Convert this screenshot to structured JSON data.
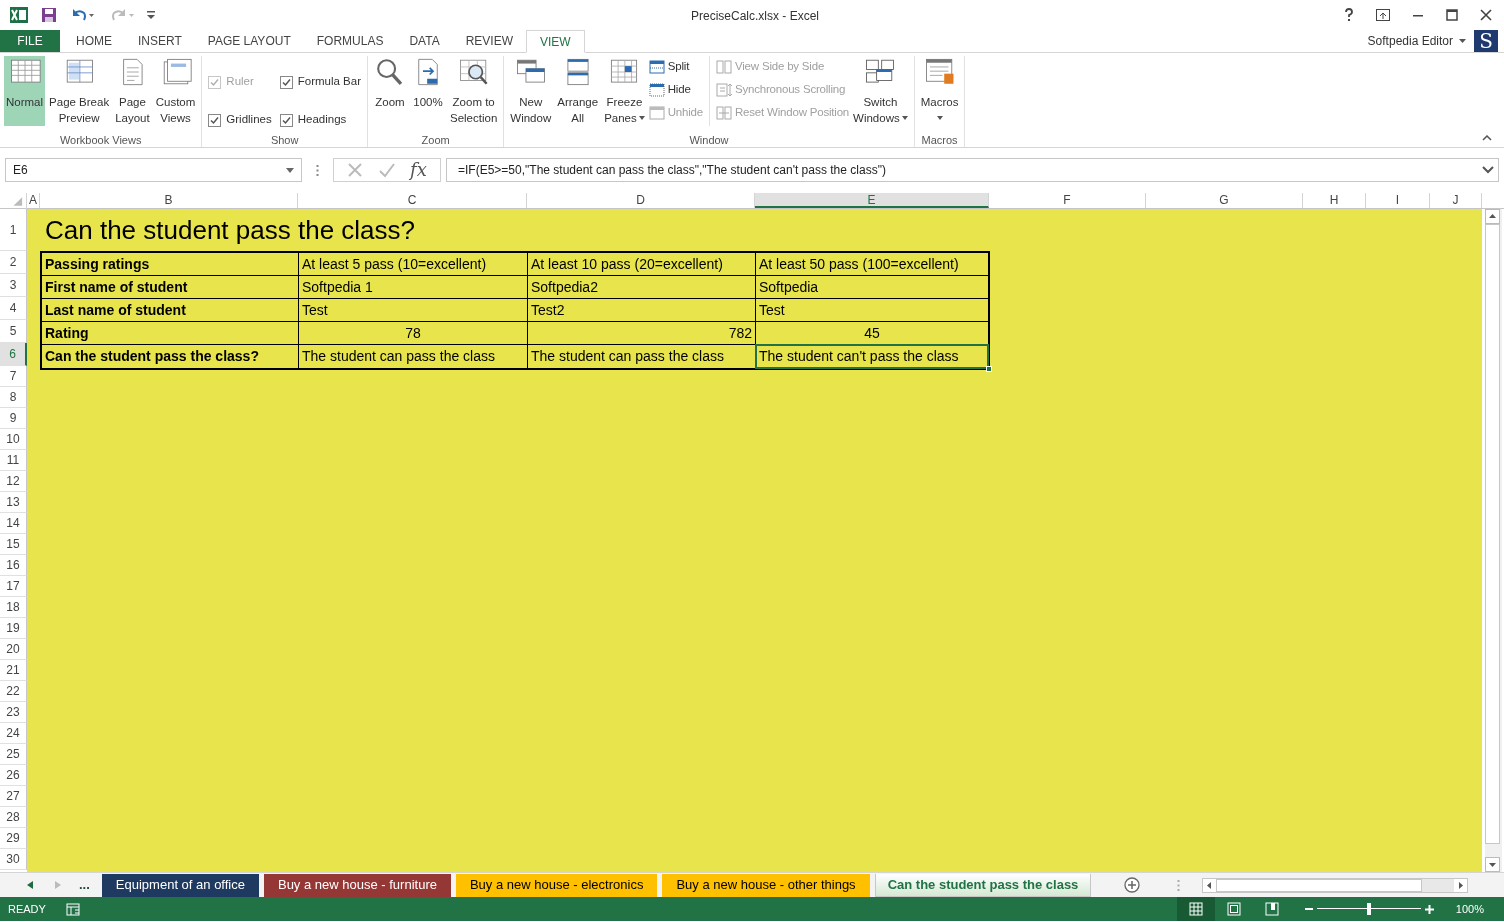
{
  "window": {
    "title": "PreciseCalc.xlsx - Excel"
  },
  "ribbon_tabs": [
    {
      "label": "FILE",
      "kind": "backstage",
      "selected": false
    },
    {
      "label": "HOME",
      "kind": "tab",
      "selected": false
    },
    {
      "label": "INSERT",
      "kind": "tab",
      "selected": false
    },
    {
      "label": "PAGE LAYOUT",
      "kind": "tab",
      "selected": false
    },
    {
      "label": "FORMULAS",
      "kind": "tab",
      "selected": false
    },
    {
      "label": "DATA",
      "kind": "tab",
      "selected": false
    },
    {
      "label": "REVIEW",
      "kind": "tab",
      "selected": false
    },
    {
      "label": "VIEW",
      "kind": "tab",
      "selected": true
    }
  ],
  "account": {
    "name": "Softpedia Editor",
    "avatar": "S"
  },
  "ribbon_groups": [
    {
      "label": "Workbook Views",
      "items": [
        {
          "kind": "large",
          "lines": [
            "Normal"
          ],
          "selected": true
        },
        {
          "kind": "large",
          "lines": [
            "Page Break",
            "Preview"
          ],
          "selected": false
        },
        {
          "kind": "large",
          "lines": [
            "Page",
            "Layout"
          ],
          "selected": false
        },
        {
          "kind": "large",
          "lines": [
            "Custom",
            "Views"
          ],
          "selected": false
        }
      ]
    },
    {
      "label": "Show",
      "items": [
        {
          "kind": "check",
          "label": "Ruler",
          "checked": true,
          "disabled": true
        },
        {
          "kind": "check",
          "label": "Gridlines",
          "checked": true,
          "disabled": false
        },
        {
          "kind": "check",
          "label": "Formula Bar",
          "checked": true,
          "disabled": false
        },
        {
          "kind": "check",
          "label": "Headings",
          "checked": true,
          "disabled": false
        }
      ]
    },
    {
      "label": "Zoom",
      "items": [
        {
          "kind": "large",
          "lines": [
            "Zoom"
          ]
        },
        {
          "kind": "large",
          "lines": [
            "100%"
          ]
        },
        {
          "kind": "large",
          "lines": [
            "Zoom to",
            "Selection"
          ]
        }
      ]
    },
    {
      "label": "Window",
      "items": [
        {
          "kind": "large",
          "lines": [
            "New",
            "Window"
          ]
        },
        {
          "kind": "large",
          "lines": [
            "Arrange",
            "All"
          ]
        },
        {
          "kind": "large",
          "lines": [
            "Freeze",
            "Panes"
          ],
          "dropdown": true
        },
        {
          "kind": "small",
          "label": "Split",
          "disabled": false
        },
        {
          "kind": "small",
          "label": "Hide",
          "disabled": false
        },
        {
          "kind": "small",
          "label": "Unhide",
          "disabled": true
        },
        {
          "kind": "small",
          "label": "View Side by Side",
          "disabled": true
        },
        {
          "kind": "small",
          "label": "Synchronous Scrolling",
          "disabled": true
        },
        {
          "kind": "small",
          "label": "Reset Window Position",
          "disabled": true
        },
        {
          "kind": "large",
          "lines": [
            "Switch",
            "Windows"
          ],
          "dropdown": true
        }
      ]
    },
    {
      "label": "Macros",
      "items": [
        {
          "kind": "large",
          "lines": [
            "Macros"
          ],
          "dropdown": true
        }
      ]
    }
  ],
  "formula_bar": {
    "name_box": "E6",
    "function_label": "fx",
    "formula": "=IF(E5>=50,\"The student can pass the class\",\"The student can't pass the class\")"
  },
  "columns": [
    {
      "label": "A",
      "selected": false
    },
    {
      "label": "B",
      "selected": false
    },
    {
      "label": "C",
      "selected": false
    },
    {
      "label": "D",
      "selected": false
    },
    {
      "label": "E",
      "selected": true
    },
    {
      "label": "F",
      "selected": false
    },
    {
      "label": "G",
      "selected": false
    },
    {
      "label": "H",
      "selected": false
    },
    {
      "label": "I",
      "selected": false
    },
    {
      "label": "J",
      "selected": false
    }
  ],
  "row_headers": [
    {
      "label": "1",
      "selected": false
    },
    {
      "label": "2",
      "selected": false
    },
    {
      "label": "3",
      "selected": false
    },
    {
      "label": "4",
      "selected": false
    },
    {
      "label": "5",
      "selected": false
    },
    {
      "label": "6",
      "selected": true
    },
    {
      "label": "7",
      "selected": false
    },
    {
      "label": "8",
      "selected": false
    },
    {
      "label": "9",
      "selected": false
    },
    {
      "label": "10",
      "selected": false
    },
    {
      "label": "11",
      "selected": false
    },
    {
      "label": "12",
      "selected": false
    },
    {
      "label": "13",
      "selected": false
    },
    {
      "label": "14",
      "selected": false
    },
    {
      "label": "15",
      "selected": false
    },
    {
      "label": "16",
      "selected": false
    },
    {
      "label": "17",
      "selected": false
    },
    {
      "label": "18",
      "selected": false
    },
    {
      "label": "19",
      "selected": false
    },
    {
      "label": "20",
      "selected": false
    },
    {
      "label": "21",
      "selected": false
    },
    {
      "label": "22",
      "selected": false
    },
    {
      "label": "23",
      "selected": false
    },
    {
      "label": "24",
      "selected": false
    },
    {
      "label": "25",
      "selected": false
    },
    {
      "label": "26",
      "selected": false
    },
    {
      "label": "27",
      "selected": false
    },
    {
      "label": "28",
      "selected": false
    },
    {
      "label": "29",
      "selected": false
    },
    {
      "label": "30",
      "selected": false
    }
  ],
  "sheet": {
    "title": "Can the student pass the class?",
    "table": [
      {
        "label": "Passing ratings",
        "cells": [
          {
            "text": "At least 5 pass (10=excellent)",
            "kind": "left",
            "selected": false
          },
          {
            "text": "At least 10 pass (20=excellent)",
            "kind": "left",
            "selected": false
          },
          {
            "text": "At least 50 pass (100=excellent)",
            "kind": "left",
            "selected": false
          }
        ]
      },
      {
        "label": "First name of student",
        "cells": [
          {
            "text": "Softpedia 1",
            "kind": "left",
            "selected": false
          },
          {
            "text": "Softpedia2",
            "kind": "left",
            "selected": false
          },
          {
            "text": "Softpedia",
            "kind": "left",
            "selected": false
          }
        ]
      },
      {
        "label": "Last name of student",
        "cells": [
          {
            "text": "Test",
            "kind": "left",
            "selected": false
          },
          {
            "text": "Test2",
            "kind": "left",
            "selected": false
          },
          {
            "text": "Test",
            "kind": "left",
            "selected": false
          }
        ]
      },
      {
        "label": "Rating",
        "cells": [
          {
            "text": "78",
            "kind": "center",
            "selected": false
          },
          {
            "text": "782",
            "kind": "right",
            "selected": false
          },
          {
            "text": "45",
            "kind": "center",
            "selected": false
          }
        ]
      },
      {
        "label": "Can the student pass the class?",
        "cells": [
          {
            "text": "The student can pass the class",
            "kind": "left",
            "selected": false
          },
          {
            "text": "The student can pass the class",
            "kind": "left",
            "selected": false
          },
          {
            "text": "The student can't pass the class",
            "kind": "left",
            "selected": true
          }
        ]
      }
    ]
  },
  "sheet_tabs": {
    "more": "...",
    "tabs": [
      {
        "label": "Equipment of an office",
        "color": "#1f3a60",
        "selected": false
      },
      {
        "label": "Buy a new house - furniture",
        "color": "#953735",
        "selected": false
      },
      {
        "label": "Buy a new house - electronics",
        "color": "#ffc000",
        "selected": false
      },
      {
        "label": "Buy a new house - other things",
        "color": "#ffc000",
        "selected": false
      },
      {
        "label": "Can the student pass the class",
        "selected": true
      }
    ]
  },
  "status_bar": {
    "mode": "READY",
    "views": [
      {
        "kind": "normal",
        "selected": true
      },
      {
        "kind": "page-layout",
        "selected": false
      },
      {
        "kind": "page-break",
        "selected": false
      }
    ],
    "zoom": {
      "level": 0.5,
      "reading": "100%"
    }
  }
}
